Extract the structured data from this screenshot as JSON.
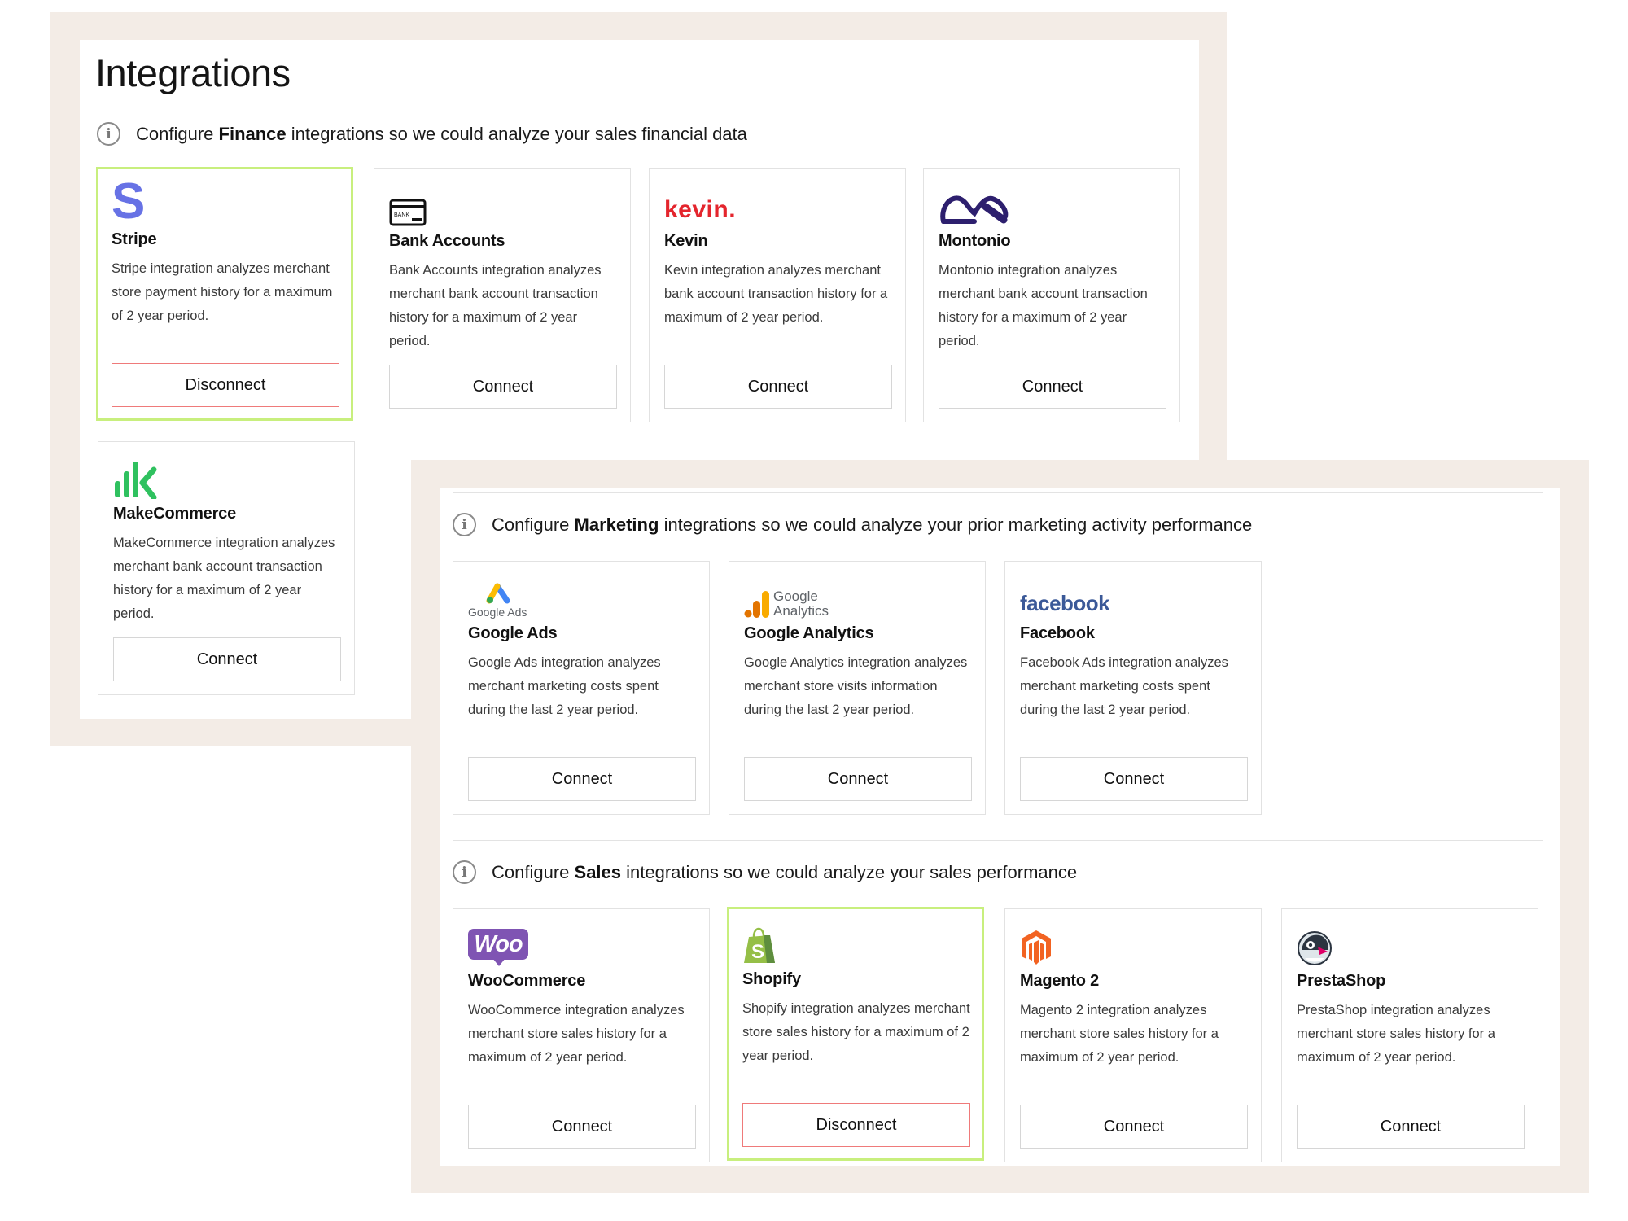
{
  "page": {
    "title": "Integrations"
  },
  "colors": {
    "frame": "#f3ece6",
    "connected_border": "#c8ef7e",
    "disconnect_border": "#ef7a7a"
  },
  "sections": {
    "finance": {
      "prefix": "Configure",
      "bold": "Finance",
      "suffix": "integrations so we could analyze your sales financial data",
      "icon": "info-icon"
    },
    "marketing": {
      "prefix": "Configure",
      "bold": "Marketing",
      "suffix": "integrations so we could analyze your prior marketing activity performance",
      "icon": "info-icon"
    },
    "sales": {
      "prefix": "Configure",
      "bold": "Sales",
      "suffix": "integrations so we could analyze your sales performance",
      "icon": "info-icon"
    }
  },
  "cards": {
    "stripe": {
      "name": "Stripe",
      "desc": "Stripe integration analyzes merchant store payment history for a maximum of 2 year period.",
      "button": "Disconnect",
      "connected": true,
      "logo_text": "S",
      "logo_color": "#6772e5"
    },
    "bank": {
      "name": "Bank Accounts",
      "desc": "Bank Accounts integration analyzes merchant bank account transaction history for a maximum of 2 year period.",
      "button": "Connect",
      "connected": false,
      "logo_text": "BANK"
    },
    "kevin": {
      "name": "Kevin",
      "desc": "Kevin integration analyzes merchant bank account transaction history for a maximum of 2 year period.",
      "button": "Connect",
      "connected": false,
      "logo_text": "kevin.",
      "logo_color": "#e4252d"
    },
    "montonio": {
      "name": "Montonio",
      "desc": "Montonio integration analyzes merchant bank account transaction history for a maximum of 2 year period.",
      "button": "Connect",
      "connected": false,
      "logo_color": "#2d1f6e"
    },
    "makecommerce": {
      "name": "MakeCommerce",
      "desc": "MakeCommerce integration analyzes merchant bank account transaction history for a maximum of 2 year period.",
      "button": "Connect",
      "connected": false,
      "logo_color": "#2fc15f"
    },
    "googleads": {
      "name": "Google Ads",
      "desc": "Google Ads integration analyzes merchant marketing costs spent during the last 2 year period.",
      "button": "Connect",
      "connected": false,
      "logo_text": "Google Ads"
    },
    "googleanalytics": {
      "name": "Google Analytics",
      "desc": "Google Analytics integration analyzes merchant store visits information during the last 2 year period.",
      "button": "Connect",
      "connected": false,
      "logo_line1": "Google",
      "logo_line2": "Analytics"
    },
    "facebook": {
      "name": "Facebook",
      "desc": "Facebook Ads integration analyzes merchant marketing costs spent during the last 2 year period.",
      "button": "Connect",
      "connected": false,
      "logo_text": "facebook",
      "logo_color": "#3b5998"
    },
    "woocommerce": {
      "name": "WooCommerce",
      "desc": "WooCommerce integration analyzes merchant store sales history for a maximum of 2 year period.",
      "button": "Connect",
      "connected": false,
      "logo_text": "Woo",
      "logo_color": "#7f54b3"
    },
    "shopify": {
      "name": "Shopify",
      "desc": "Shopify integration analyzes merchant store sales history for a maximum of 2 year period.",
      "button": "Disconnect",
      "connected": true,
      "logo_text": "S",
      "logo_color": "#95bf47"
    },
    "magento": {
      "name": "Magento 2",
      "desc": "Magento 2 integration analyzes merchant store sales history for a maximum of 2 year period.",
      "button": "Connect",
      "connected": false,
      "logo_color": "#f26322"
    },
    "prestashop": {
      "name": "PrestaShop",
      "desc": "PrestaShop integration analyzes merchant store sales history for a maximum of 2 year period.",
      "button": "Connect",
      "connected": false
    }
  }
}
